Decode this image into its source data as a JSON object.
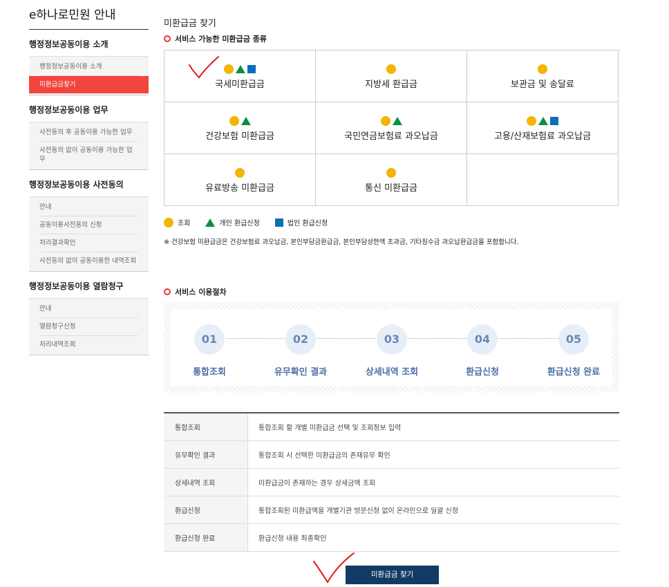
{
  "sidebar": {
    "title": "e하나로민원 안내",
    "sections": [
      {
        "title": "행정정보공동이용 소개",
        "items": [
          "행정정보공동이용 소개",
          "미환급금찾기"
        ]
      },
      {
        "title": "행정정보공동이용 업무",
        "items": [
          "사전동의 후 공동이용 가능한 업무",
          "사전동의 없이 공동이용 가능한 업무"
        ]
      },
      {
        "title": "행정정보공동이용 사전동의",
        "items": [
          "안내",
          "공동이용사전동의 신청",
          "처리결과확인",
          "사전동의 없이 공동이용한 내역조회"
        ]
      },
      {
        "title": "행정정보공동이용 열람청구",
        "items": [
          "안내",
          "열람청구신청",
          "처리내역조회"
        ]
      }
    ]
  },
  "main": {
    "page_title": "미환급금 찾기",
    "types_heading": "서비스 가능한 미환급금 종류",
    "types": [
      {
        "label": "국세미환급금",
        "icons": [
          "circle",
          "triangle",
          "square"
        ]
      },
      {
        "label": "지방세 환급금",
        "icons": [
          "circle"
        ]
      },
      {
        "label": "보관금 및 송달료",
        "icons": [
          "circle"
        ]
      },
      {
        "label": "건강보험 미환급금",
        "icons": [
          "circle",
          "triangle"
        ]
      },
      {
        "label": "국민연금보험료 과오납금",
        "icons": [
          "circle",
          "triangle"
        ]
      },
      {
        "label": "고용/산재보험료 과오납금",
        "icons": [
          "circle",
          "triangle",
          "square"
        ]
      },
      {
        "label": "유료방송 미환급금",
        "icons": [
          "circle"
        ]
      },
      {
        "label": "통신 미환급금",
        "icons": [
          "circle"
        ]
      },
      {
        "label": "",
        "icons": []
      }
    ],
    "legend": {
      "circle": "조회",
      "triangle": "개인 환급신청",
      "square": "법인 환급신청"
    },
    "note": "※ 건강보험 미환급금은 건강보험료 과오납금, 본인부담금환급금, 본인부담상한액 초과금, 기타징수금 과오납환급금을 포함합니다.",
    "process_heading": "서비스 이용절차",
    "steps": [
      {
        "num": "01",
        "name": "통합조회"
      },
      {
        "num": "02",
        "name": "유무확인 결과"
      },
      {
        "num": "03",
        "name": "상세내역 조회"
      },
      {
        "num": "04",
        "name": "환급신청"
      },
      {
        "num": "05",
        "name": "환급신청 완료"
      }
    ],
    "process_table": [
      {
        "step": "통합조회",
        "desc": "통합조회 할 개별 미환급금 선택 및 조회정보 입력"
      },
      {
        "step": "유무확인 결과",
        "desc": "통합조회 시 선택한 미환급금의 존재유무 확인"
      },
      {
        "step": "상세내역 조회",
        "desc": "미환급금이 존재하는 경우 상세금액 조회"
      },
      {
        "step": "환급신청",
        "desc": "통합조회된 미환급액을 개별기관 방문신청 없이 온라인으로 일괄 신청"
      },
      {
        "step": "환급신청 완료",
        "desc": "환급신청 내용 최종확인"
      }
    ],
    "search_button": "미환급금 찾기"
  },
  "colors": {
    "accent_red": "#f1453d",
    "button_navy": "#133a63",
    "circle": "#f4b400",
    "triangle": "#0a8f43",
    "square": "#0b6fb3",
    "step_text": "#4c6ea7"
  }
}
